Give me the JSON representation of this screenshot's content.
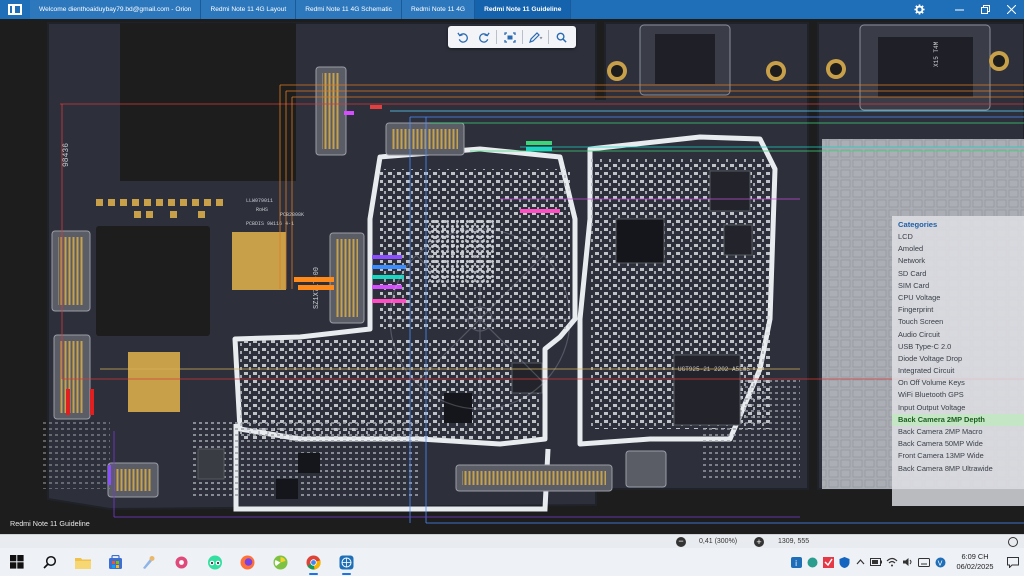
{
  "tabbar": {
    "tabs": [
      {
        "label": "Welcome dienthoaiduybay79.bd@gmail.com - Orion",
        "active": false
      },
      {
        "label": "Redmi Note 11 4G Layout",
        "active": false
      },
      {
        "label": "Redmi Note 11 4G Schematic",
        "active": false
      },
      {
        "label": "Redmi Note 11 4G",
        "active": false
      },
      {
        "label": "Redmi Note 11 Guideline",
        "active": true
      }
    ],
    "settings_icon": "gear-icon",
    "window_controls": [
      "minimize",
      "restore",
      "close"
    ]
  },
  "toolbar": {
    "tools": [
      "rotate-left-icon",
      "rotate-right-icon",
      "fit-screen-icon",
      "pen-icon",
      "search-icon"
    ]
  },
  "board": {
    "chip_markings": {
      "label_block": [
        "LLW079011",
        "RoHS",
        "PCB2808K",
        "PCBDIS 9W116 4-1"
      ],
      "connector_code": "SZ1X71T-00",
      "left_code": "98436",
      "pmic": "UGT925-21 2202 A5E65",
      "top_right_chip": "X15 T4M"
    }
  },
  "categories": {
    "title": "Categories",
    "selected": "Back Camera 2MP Depth",
    "items": [
      "LCD",
      "Amoled",
      "Network",
      "SD Card",
      "SIM Card",
      "CPU Voltage",
      "Fingerprint",
      "Touch Screen",
      "Audio Circuit",
      "USB Type-C 2.0",
      "Diode Voltage Drop",
      "Integrated Circuit",
      "On Off Volume Keys",
      "WiFi Bluetooth GPS",
      "Input Output Voltage",
      "Back Camera 2MP Depth",
      "Back Camera 2MP Macro",
      "Back Camera 50MP Wide",
      "Front Camera 13MP Wide",
      "Back Camera 8MP Ultrawide"
    ]
  },
  "viewer": {
    "caption": "Redmi Note 11 Guideline"
  },
  "status": {
    "zoom_level": "0,41 (300%)",
    "coordinates": "1309, 555"
  },
  "taskbar": {
    "apps": [
      "start-icon",
      "search-icon",
      "file-explorer-icon",
      "store-icon",
      "paint-icon",
      "settings-app-icon",
      "tripadvisor-icon",
      "firefox-icon",
      "pinwheel-icon",
      "chrome-icon",
      "orion-icon"
    ],
    "clock_time": "6:09 CH",
    "clock_date": "06/02/2025"
  },
  "colors": {
    "tab_bar": "#1f6fb8",
    "board": "#2d2f3b",
    "trace_white": "#e9ecef",
    "gold": "#c9a04a",
    "category_title": "#1f5fa6",
    "category_selected": "#c4e6c4"
  }
}
